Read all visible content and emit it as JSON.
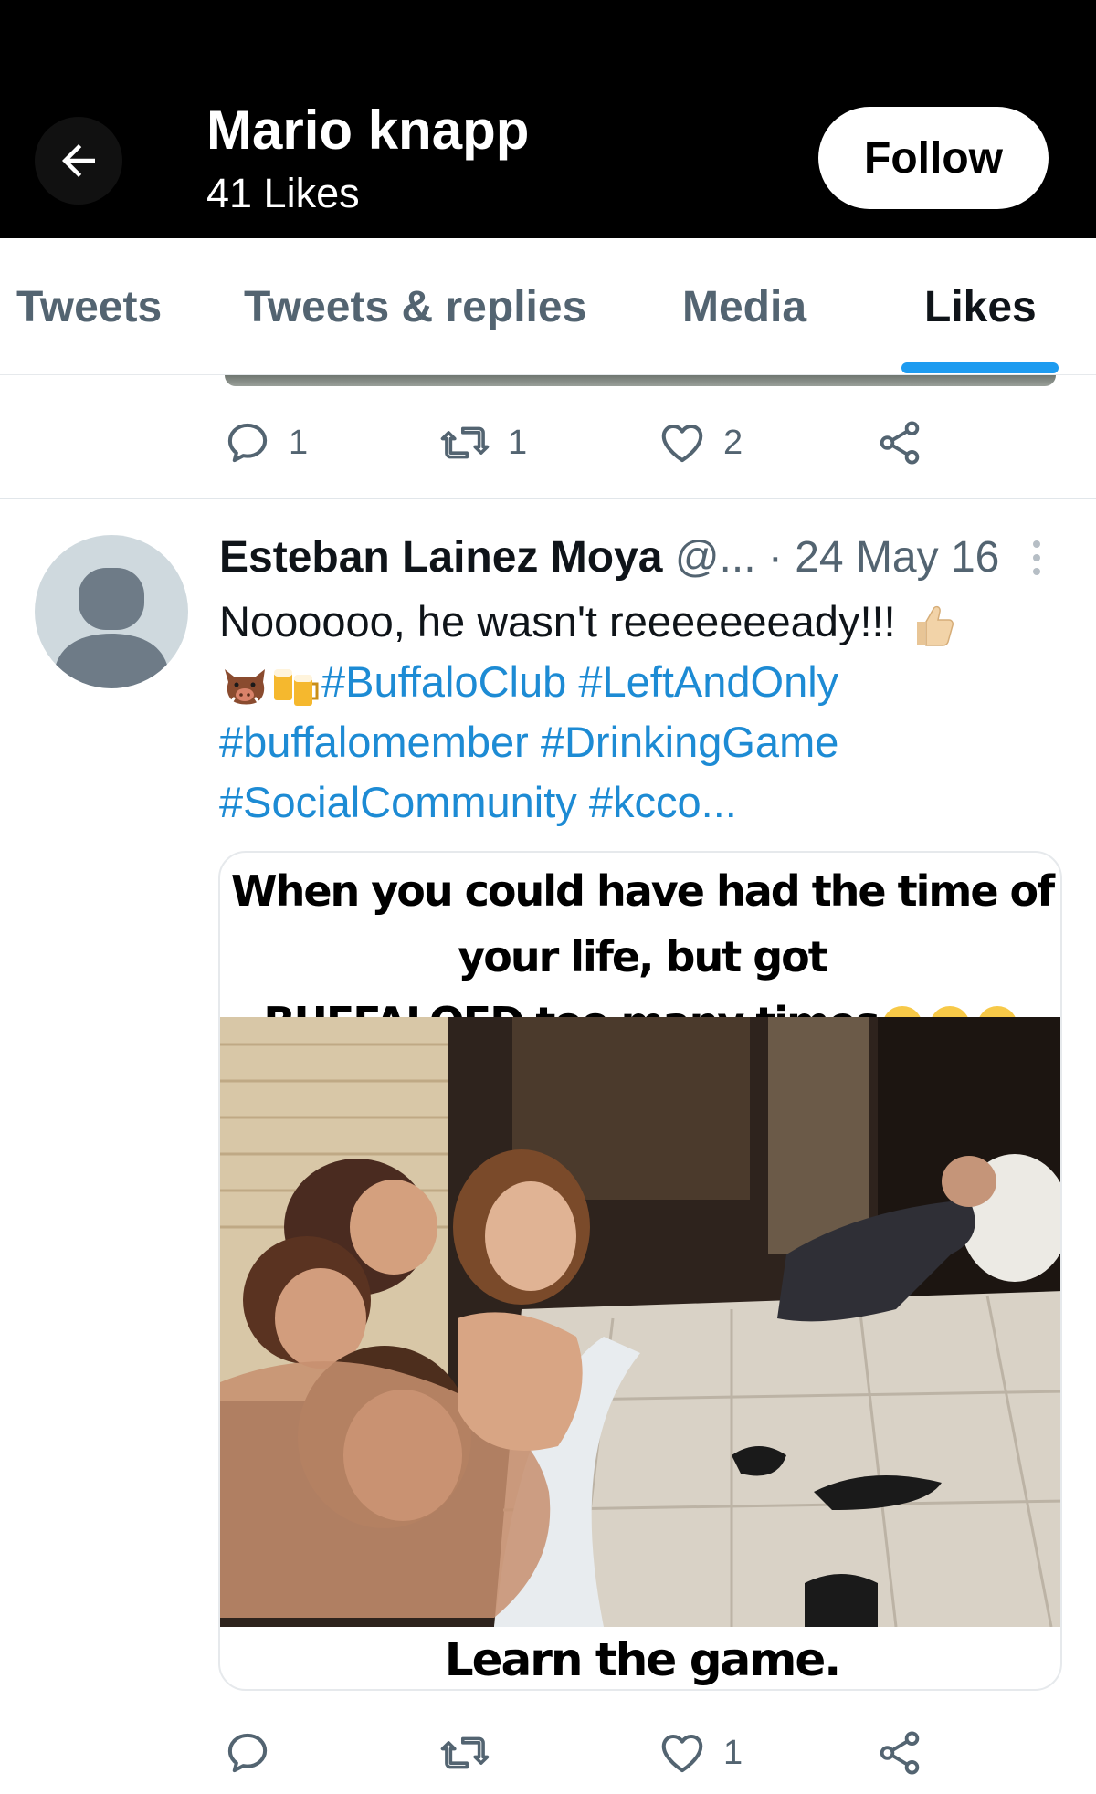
{
  "header": {
    "name": "Mario knapp",
    "subtitle": "41 Likes",
    "follow_label": "Follow"
  },
  "tabs": [
    {
      "label": "Tweets",
      "active": false
    },
    {
      "label": "Tweets & replies",
      "active": false
    },
    {
      "label": "Media",
      "active": false
    },
    {
      "label": "Likes",
      "active": true
    }
  ],
  "previous_tweet": {
    "replies": "1",
    "retweets": "1",
    "likes": "2"
  },
  "tweet": {
    "author": "Esteban Lainez Moya",
    "handle": "@...",
    "separator": "·",
    "date": "24 May 16",
    "text_line1": "Noooooo, he wasn't reeeeeeeady!!!",
    "hashtags": [
      "#BuffaloClub",
      "#LeftAndOnly",
      "#buffalomember",
      "#DrinkingGame",
      "#SocialCommunity",
      "#kcco..."
    ],
    "emojis": [
      "thumbs-up-icon",
      "boar-icon",
      "beer-mugs-icon"
    ],
    "media": {
      "top_caption_line1": "When you could have had the time of your life, but got",
      "top_caption_line2": "BUFFALOED too many times",
      "caption_emojis": [
        "tears-of-joy-icon",
        "tears-of-joy-icon",
        "tears-of-joy-icon"
      ],
      "bottom_caption": "Learn the game."
    },
    "replies": "",
    "retweets": "",
    "likes": "1"
  },
  "colors": {
    "header_bg": "#000000",
    "accent": "#1d9bf0",
    "hashtag": "#1d8bd4",
    "muted": "#536471"
  }
}
